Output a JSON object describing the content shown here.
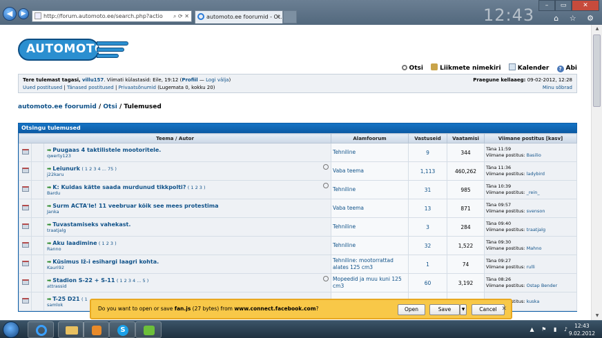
{
  "browser": {
    "address": "http://forum.automoto.ee/search.php?actio",
    "tab_title": "automoto.ee foorumid - Ot...",
    "tab_close": "×",
    "window": {
      "min": "–",
      "max": "▭",
      "close": "✕"
    },
    "tools": "⌂ ☆ ⚙",
    "bg_clock": "12:43"
  },
  "site": {
    "logo_text": "AUTOMOTO.EE",
    "top_links": [
      "Otsi",
      "Liikmete nimekiri",
      "Kalender",
      "Abi"
    ]
  },
  "infobox": {
    "greeting_prefix": "Tere tulemast tagasi,",
    "username": "villu157",
    "last_visit": ". Viimati külastasid: Eile, 19:12 (",
    "profile": "Profiil",
    "sep": " — ",
    "logout": "Logi välja",
    "close_paren": ")",
    "new_posts": "Uued postitused",
    "today_posts": "Tänased postitused",
    "private": "Privaatsõnumid",
    "unread": "(Lugemata 0, kokku 20)",
    "current_time_label": "Praegune kellaaeg:",
    "current_time": "09-02-2012, 12:28",
    "friends": "Minu sõbrad"
  },
  "breadcrumb": {
    "home": "automoto.ee foorumid",
    "search": "Otsi",
    "current": "Tulemused",
    "sep": "/"
  },
  "results": {
    "title": "Otsingu tulemused",
    "headers": [
      "Teema / Autor",
      "Alamfoorum",
      "Vastuseid",
      "Vaatamisi",
      "Viimane postitus [kasv]"
    ],
    "rows": [
      {
        "title": "Puugaas 4 taktilistele mootoritele.",
        "pages": "",
        "author": "qwerty123",
        "forum": "Tehniline",
        "replies": "9",
        "views": "344",
        "time": "Täna 11:59",
        "last_label": "Viimane postitus:",
        "last_user": "Basilio",
        "clip": false
      },
      {
        "title": "Leiunurk",
        "pages": "( 1 2 3 4 ... 75 )",
        "author": "j22karu",
        "forum": "Vaba teema",
        "replies": "1,113",
        "views": "460,262",
        "time": "Täna 11:36",
        "last_label": "Viimane postitus:",
        "last_user": "ladybird",
        "clip": true
      },
      {
        "title": "K: Kuidas kätte saada murdunud tikkpolti?",
        "pages": "( 1 2 3 )",
        "author": "Bardu",
        "forum": "Tehniline",
        "replies": "31",
        "views": "985",
        "time": "Täna 10:39",
        "last_label": "Viimane postitus:",
        "last_user": "_rein_",
        "clip": true
      },
      {
        "title": "Surm ACTA'le! 11 veebruar kõik see mees protestima",
        "pages": "",
        "author": "Janka",
        "forum": "Vaba teema",
        "replies": "13",
        "views": "871",
        "time": "Täna 09:57",
        "last_label": "Viimane postitus:",
        "last_user": "svenson",
        "clip": false
      },
      {
        "title": "Tuvastamiseks vahekast.",
        "pages": "",
        "author": "traatjalg",
        "forum": "Tehniline",
        "replies": "3",
        "views": "284",
        "time": "Täna 09:40",
        "last_label": "Viimane postitus:",
        "last_user": "traatjalg",
        "clip": false
      },
      {
        "title": "Aku laadimine",
        "pages": "( 1 2 3 )",
        "author": "Ranno",
        "forum": "Tehniline",
        "replies": "32",
        "views": "1,522",
        "time": "Täna 09:30",
        "last_label": "Viimane postitus:",
        "last_user": "Mahno",
        "clip": false
      },
      {
        "title": "Küsimus Iž-i esihargi laagri kohta.",
        "pages": "",
        "author": "Kauri92",
        "forum": "Tehniline: mootorrattad alates 125 cm3",
        "replies": "1",
        "views": "74",
        "time": "Täna 09:27",
        "last_label": "Viimane postitus:",
        "last_user": "rulli",
        "clip": false
      },
      {
        "title": "Stadion S-22 + S-11",
        "pages": "( 1 2 3 4 ... 5 )",
        "author": "attrassid",
        "forum": "Mopeedid ja muu kuni 125 cm3",
        "replies": "60",
        "views": "3,192",
        "time": "Täna 08:26",
        "last_label": "Viimane postitus:",
        "last_user": "Ostap Bender",
        "clip": true
      },
      {
        "title": "T-25 D21",
        "pages": "( 1",
        "author": "samlok",
        "forum": "",
        "replies": "",
        "views": "",
        "time": "",
        "last_label": "Viimane postitus:",
        "last_user": "kuska",
        "clip": false
      }
    ]
  },
  "download_bar": {
    "prefix": "Do you want to open or save ",
    "file": "fan.js",
    "size": " (27 bytes) from ",
    "host": "www.connect.facebook.com",
    "suffix": "?",
    "open": "Open",
    "save": "Save",
    "save_arrow": "▼",
    "cancel": "Cancel",
    "close": "✕"
  },
  "taskbar": {
    "skype_letter": "S",
    "tray": "▲ ⚑ ▮ ♪",
    "time": "12:43",
    "date": "9.02.2012"
  }
}
